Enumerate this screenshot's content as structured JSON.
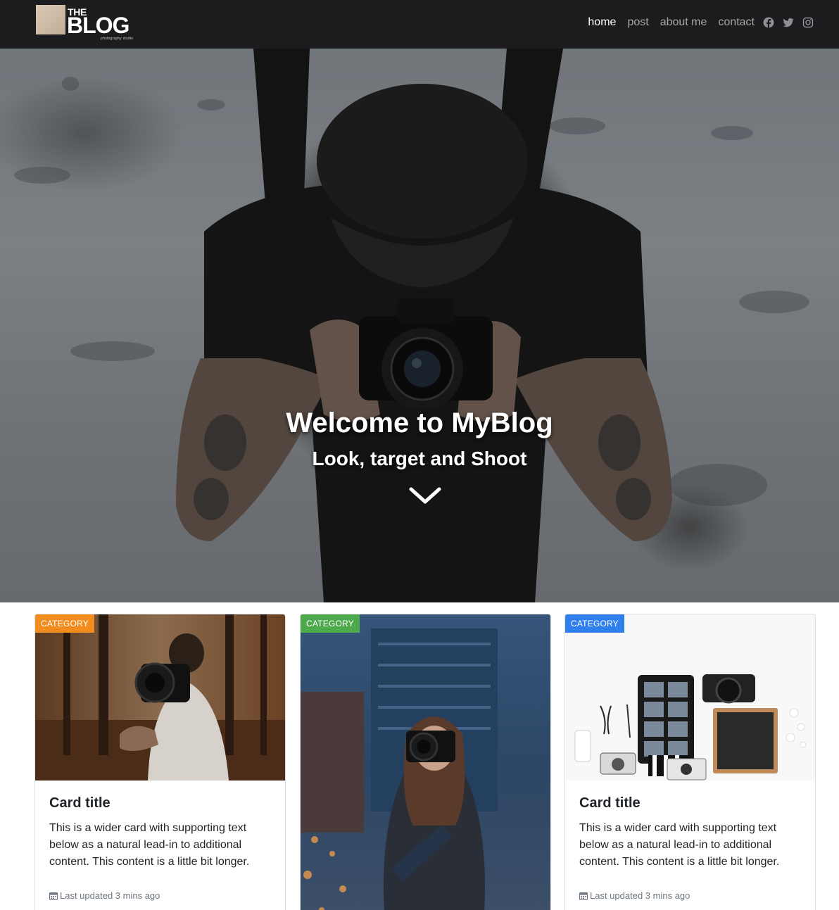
{
  "brand": {
    "the": "THE",
    "blog": "BLOG",
    "sub": "photography studio"
  },
  "nav": {
    "items": [
      {
        "label": "home",
        "active": true
      },
      {
        "label": "post",
        "active": false
      },
      {
        "label": "about me",
        "active": false
      },
      {
        "label": "contact",
        "active": false
      }
    ],
    "social": [
      "facebook-icon",
      "twitter-icon",
      "instagram-icon"
    ]
  },
  "hero": {
    "title": "Welcome to MyBlog",
    "subtitle": "Look, target and Shoot",
    "arrow_icon": "chevron-down-icon"
  },
  "cards": [
    {
      "badge": "CATEGORY",
      "badge_color": "#f28c1f",
      "title": "Card title",
      "text": "This is a wider card with supporting text below as a natural lead-in to additional content. This content is a little bit longer.",
      "meta": "Last updated 3 mins ago",
      "meta_icon": "calendar-icon"
    },
    {
      "badge": "CATEGORY",
      "badge_color": "#4caa4c"
    },
    {
      "badge": "CATEGORY",
      "badge_color": "#2f80ed",
      "title": "Card title",
      "text": "This is a wider card with supporting text below as a natural lead-in to additional content. This content is a little bit longer.",
      "meta": "Last updated 3 mins ago",
      "meta_icon": "calendar-icon"
    }
  ],
  "colors": {
    "navbar_bg": "#1c1c1f",
    "nav_active": "#ffffff",
    "nav_inactive": "rgba(255,255,255,0.6)"
  }
}
